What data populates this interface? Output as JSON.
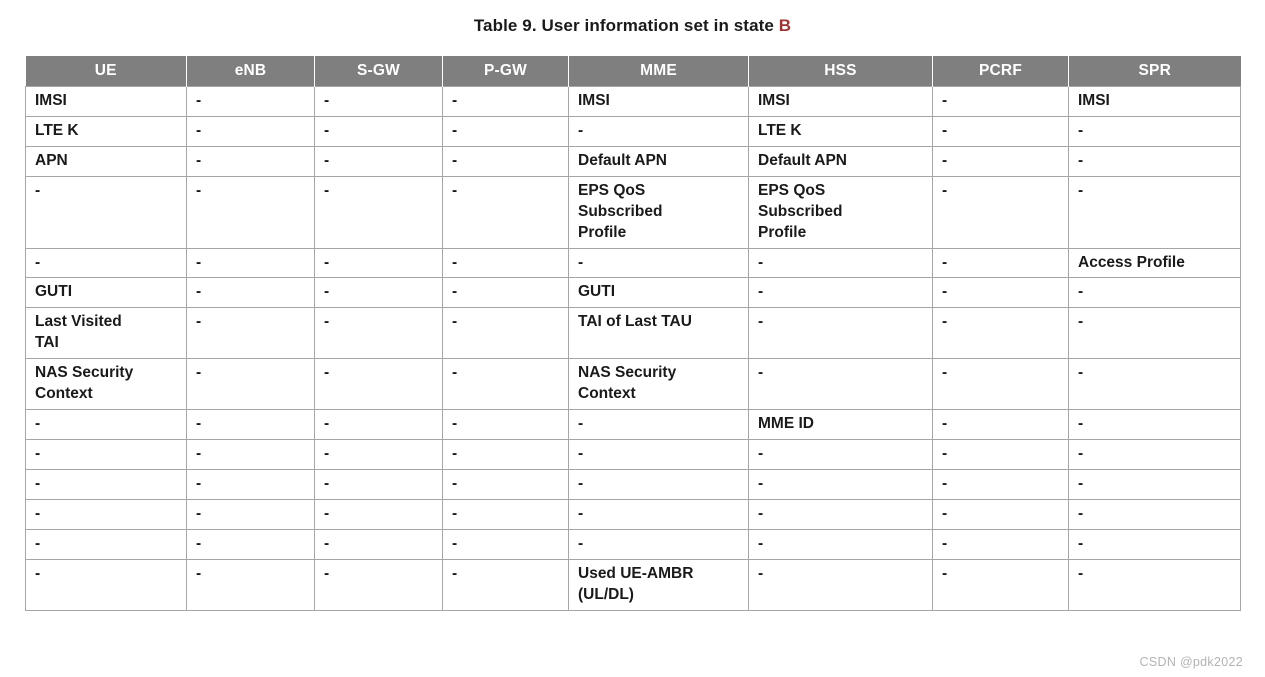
{
  "caption": {
    "prefix": "Table 9. User information set in state ",
    "state": "B",
    "state_color": "#9e3434"
  },
  "colors": {
    "header_bg": "#7f7f7f",
    "header_text": "#ffffff",
    "highlight_blue": "#4a7ebb",
    "normal_text": "#1a1a1a",
    "border": "#a6a6a6",
    "watermark": "#b3b3b3"
  },
  "table": {
    "columns": [
      "UE",
      "eNB",
      "S-GW",
      "P-GW",
      "MME",
      "HSS",
      "PCRF",
      "SPR"
    ],
    "dash": "-",
    "rows": [
      {
        "height_class": "r-h1",
        "cells": [
          {
            "text": "IMSI",
            "style": "black"
          },
          {
            "text": "-",
            "style": "dash"
          },
          {
            "text": "-",
            "style": "dash"
          },
          {
            "text": "-",
            "style": "dash"
          },
          {
            "text": "IMSI",
            "style": "blue"
          },
          {
            "text": "IMSI",
            "style": "black"
          },
          {
            "text": "-",
            "style": "dash"
          },
          {
            "text": "IMSI",
            "style": "black"
          }
        ]
      },
      {
        "height_class": "r-h1",
        "cells": [
          {
            "text": "LTE K",
            "style": "black"
          },
          {
            "text": "-",
            "style": "dash"
          },
          {
            "text": "-",
            "style": "dash"
          },
          {
            "text": "-",
            "style": "dash"
          },
          {
            "text": "-",
            "style": "dash"
          },
          {
            "text": "LTE K",
            "style": "black"
          },
          {
            "text": "-",
            "style": "dash"
          },
          {
            "text": "-",
            "style": "dash"
          }
        ]
      },
      {
        "height_class": "r-h1",
        "cells": [
          {
            "text": "APN",
            "style": "black"
          },
          {
            "text": "-",
            "style": "dash"
          },
          {
            "text": "-",
            "style": "dash"
          },
          {
            "text": "-",
            "style": "dash"
          },
          {
            "text": "Default APN",
            "style": "blue"
          },
          {
            "text": "Default APN",
            "style": "black"
          },
          {
            "text": "-",
            "style": "dash"
          },
          {
            "text": "-",
            "style": "dash"
          }
        ]
      },
      {
        "height_class": "r-h3",
        "cells": [
          {
            "text": "-",
            "style": "dash"
          },
          {
            "text": "-",
            "style": "dash"
          },
          {
            "text": "-",
            "style": "dash"
          },
          {
            "text": "-",
            "style": "dash"
          },
          {
            "text": "EPS QoS\nSubscribed\nProfile",
            "style": "blue"
          },
          {
            "text": "EPS QoS\nSubscribed\nProfile",
            "style": "black"
          },
          {
            "text": "-",
            "style": "dash"
          },
          {
            "text": "-",
            "style": "dash"
          }
        ]
      },
      {
        "height_class": "r-h1",
        "cells": [
          {
            "text": "-",
            "style": "dash"
          },
          {
            "text": "-",
            "style": "dash"
          },
          {
            "text": "-",
            "style": "dash"
          },
          {
            "text": "-",
            "style": "dash"
          },
          {
            "text": "-",
            "style": "dash"
          },
          {
            "text": "-",
            "style": "dash"
          },
          {
            "text": "-",
            "style": "dash"
          },
          {
            "text": "Access Profile",
            "style": "black"
          }
        ]
      },
      {
        "height_class": "r-h1",
        "cells": [
          {
            "text": "GUTI",
            "style": "blue"
          },
          {
            "text": "-",
            "style": "dash"
          },
          {
            "text": "-",
            "style": "dash"
          },
          {
            "text": "-",
            "style": "dash"
          },
          {
            "text": "GUTI",
            "style": "blue"
          },
          {
            "text": "-",
            "style": "dash"
          },
          {
            "text": "-",
            "style": "dash"
          },
          {
            "text": "-",
            "style": "dash"
          }
        ]
      },
      {
        "height_class": "r-h2",
        "cells": [
          {
            "text": "Last Visited\nTAI",
            "style": "blue"
          },
          {
            "text": "-",
            "style": "dash"
          },
          {
            "text": "-",
            "style": "dash"
          },
          {
            "text": "-",
            "style": "dash"
          },
          {
            "text": "TAI of Last TAU",
            "style": "blue"
          },
          {
            "text": "-",
            "style": "dash"
          },
          {
            "text": "-",
            "style": "dash"
          },
          {
            "text": "-",
            "style": "dash"
          }
        ]
      },
      {
        "height_class": "r-h2",
        "cells": [
          {
            "text": "NAS Security\nContext",
            "style": "blue"
          },
          {
            "text": "-",
            "style": "dash"
          },
          {
            "text": "-",
            "style": "dash"
          },
          {
            "text": "-",
            "style": "dash"
          },
          {
            "text": "NAS Security\nContext",
            "style": "blue"
          },
          {
            "text": "-",
            "style": "dash"
          },
          {
            "text": "-",
            "style": "dash"
          },
          {
            "text": "-",
            "style": "dash"
          }
        ]
      },
      {
        "height_class": "r-h1",
        "cells": [
          {
            "text": "-",
            "style": "dash"
          },
          {
            "text": "-",
            "style": "dash"
          },
          {
            "text": "-",
            "style": "dash"
          },
          {
            "text": "-",
            "style": "dash"
          },
          {
            "text": "-",
            "style": "dash"
          },
          {
            "text": "MME ID",
            "style": "blue"
          },
          {
            "text": "-",
            "style": "dash"
          },
          {
            "text": "-",
            "style": "dash"
          }
        ]
      },
      {
        "height_class": "r-h1",
        "cells": [
          {
            "text": "-",
            "style": "dash"
          },
          {
            "text": "-",
            "style": "dash"
          },
          {
            "text": "-",
            "style": "dash"
          },
          {
            "text": "-",
            "style": "dash"
          },
          {
            "text": "-",
            "style": "dash"
          },
          {
            "text": "-",
            "style": "dash"
          },
          {
            "text": "-",
            "style": "dash"
          },
          {
            "text": "-",
            "style": "dash"
          }
        ]
      },
      {
        "height_class": "r-h1",
        "cells": [
          {
            "text": "-",
            "style": "dash"
          },
          {
            "text": "-",
            "style": "dash"
          },
          {
            "text": "-",
            "style": "dash"
          },
          {
            "text": "-",
            "style": "dash"
          },
          {
            "text": "-",
            "style": "dash"
          },
          {
            "text": "-",
            "style": "dash"
          },
          {
            "text": "-",
            "style": "dash"
          },
          {
            "text": "-",
            "style": "dash"
          }
        ]
      },
      {
        "height_class": "r-h1",
        "cells": [
          {
            "text": "-",
            "style": "dash"
          },
          {
            "text": "-",
            "style": "dash"
          },
          {
            "text": "-",
            "style": "dash"
          },
          {
            "text": "-",
            "style": "dash"
          },
          {
            "text": "-",
            "style": "dash"
          },
          {
            "text": "-",
            "style": "dash"
          },
          {
            "text": "-",
            "style": "dash"
          },
          {
            "text": "-",
            "style": "dash"
          }
        ]
      },
      {
        "height_class": "r-h1",
        "cells": [
          {
            "text": "-",
            "style": "dash"
          },
          {
            "text": "-",
            "style": "dash"
          },
          {
            "text": "-",
            "style": "dash"
          },
          {
            "text": "-",
            "style": "dash"
          },
          {
            "text": "-",
            "style": "dash"
          },
          {
            "text": "-",
            "style": "dash"
          },
          {
            "text": "-",
            "style": "dash"
          },
          {
            "text": "-",
            "style": "dash"
          }
        ]
      },
      {
        "height_class": "r-h2",
        "cells": [
          {
            "text": "-",
            "style": "dash"
          },
          {
            "text": "-",
            "style": "dash"
          },
          {
            "text": "-",
            "style": "dash"
          },
          {
            "text": "-",
            "style": "dash"
          },
          {
            "text": "Used UE-AMBR\n(UL/DL)",
            "style": "blue"
          },
          {
            "text": "-",
            "style": "dash"
          },
          {
            "text": "-",
            "style": "dash"
          },
          {
            "text": "-",
            "style": "dash"
          }
        ]
      }
    ]
  },
  "watermark": "CSDN @pdk2022"
}
